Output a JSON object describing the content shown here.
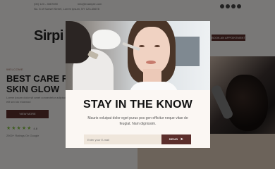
{
  "topbar": {
    "phone": "(00) 123 - 4567890",
    "email": "info@example.com",
    "address": "No. 8 of Sunset Street, Lorem Ipsum, NY 123-45678"
  },
  "brand": {
    "logo": "Sirpi"
  },
  "nav": {
    "cta": "BOOK AN APPOINTMENT"
  },
  "hero": {
    "eyebrow": "WELCOME",
    "title_line1": "BEST CARE FOR",
    "title_line2": "SKIN GLOW",
    "paragraph": "Lorem ipsum dolor sit amet consectetur adipiscing elit sed do eiusmod",
    "button": "VIEW MORE",
    "stars": "★★★★★",
    "rating": "4.8",
    "reviews": "2500+ Ratings On Google"
  },
  "modal": {
    "title": "STAY IN THE KNOW",
    "description": "Mauris volutpat dolor eget purus pos gen efficitur neque vitae de feugiat. Nam dignissim.",
    "email_placeholder": "Enter your E-mail",
    "send_label": "SEND",
    "send_icon": "➤"
  },
  "colors": {
    "accent": "#5b2e2b",
    "rating": "#7dbb3f",
    "modal_bg": "#fbf7f3"
  }
}
